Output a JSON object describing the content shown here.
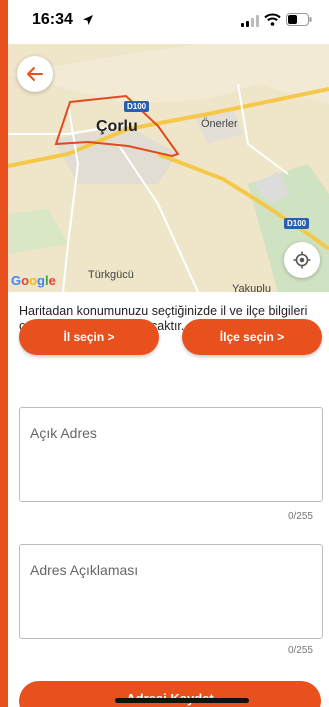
{
  "status_bar": {
    "time": "16:34"
  },
  "map": {
    "city": "Çorlu",
    "places": [
      "Önerler",
      "Türkgücü",
      "Yakuplu"
    ],
    "roads": [
      "D100",
      "D100"
    ],
    "attribution": "Google"
  },
  "form": {
    "info": "Haritadan konumunuzu seçtiğinizde il ve ilçe bilgileri otomatik olarak algılanacaktır.",
    "province_button": "İl seçin >",
    "district_button": "İlçe seçin >",
    "address": {
      "placeholder": "Açık Adres",
      "counter": "0/255"
    },
    "description": {
      "placeholder": "Adres Açıklaması",
      "counter": "0/255"
    },
    "save_button": "Adresi Kaydet"
  },
  "colors": {
    "accent": "#e8511e",
    "map_land": "#efe5c9",
    "road": "#f6c84a",
    "boundary": "#e04a1c"
  }
}
